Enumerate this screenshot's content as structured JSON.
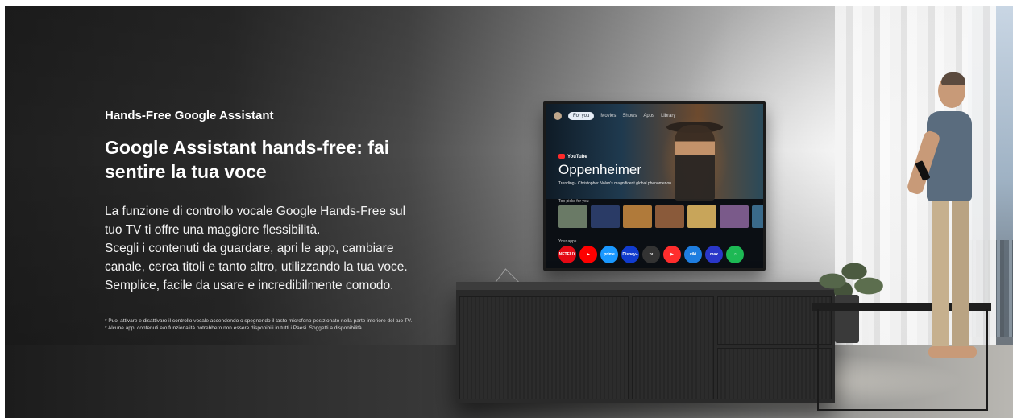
{
  "banner": {
    "eyebrow": "Hands-Free Google Assistant",
    "headline": "Google Assistant hands-free: fai sentire la tua voce",
    "body": [
      "La funzione di controllo vocale Google Hands-Free sul",
      "tuo TV ti offre una maggiore flessibilità.",
      "Scegli i contenuti da guardare, apri le app, cambiare",
      "canale, cerca titoli e tanto altro, utilizzando la tua voce.",
      "Semplice, facile da usare e incredibilmente comodo."
    ],
    "footnotes": [
      "* Puoi attivare e disattivare il controllo vocale accendendo o spegnendo il tasto microfono posizionato nella parte inferiore del tuo TV.",
      "* Alcune app, contenuti e/o funzionalità potrebbero non essere disponibili in tutti i Paesi. Soggetti a disponibilità."
    ]
  },
  "tv_screen": {
    "nav": [
      "For you",
      "Movies",
      "Shows",
      "Apps",
      "Library"
    ],
    "source_badge": "YouTube",
    "feature_title": "Oppenheimer",
    "feature_subtitle": "Trending · Christopher Nolan's magnificent global phenomenon",
    "row_label": "Top picks for you",
    "apps_label": "Your apps",
    "apps": [
      {
        "label": "NETFLIX",
        "color": "#e50914"
      },
      {
        "label": "▶",
        "color": "#ff0000"
      },
      {
        "label": "prime",
        "color": "#1a98ff"
      },
      {
        "label": "Disney+",
        "color": "#113ccf"
      },
      {
        "label": "tv",
        "color": "#333333"
      },
      {
        "label": "▶",
        "color": "#ff2d2d"
      },
      {
        "label": "viki",
        "color": "#1e7de0"
      },
      {
        "label": "max",
        "color": "#2a37c9"
      },
      {
        "label": "♫",
        "color": "#1db954"
      }
    ],
    "thumbnails": [
      "#6a7a66",
      "#2a3b66",
      "#b07a3a",
      "#8a5a3a",
      "#c8a55a",
      "#7a5a8a",
      "#3a6a8a",
      "#a33a3a"
    ]
  }
}
